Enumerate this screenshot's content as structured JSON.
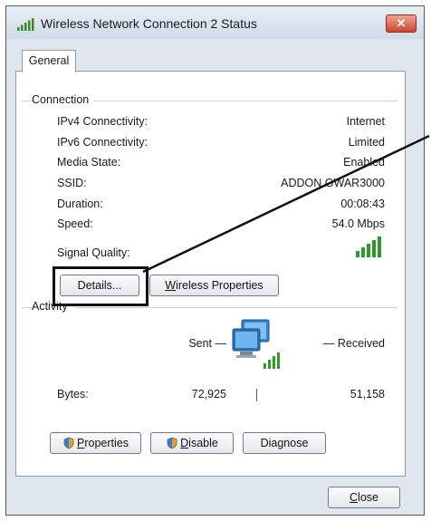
{
  "window": {
    "title": "Wireless Network Connection 2 Status",
    "close_glyph": "✕"
  },
  "tabs": [
    "General"
  ],
  "connection": {
    "section_label": "Connection",
    "rows": [
      {
        "label": "IPv4 Connectivity:",
        "value": "Internet"
      },
      {
        "label": "IPv6 Connectivity:",
        "value": "Limited"
      },
      {
        "label": "Media State:",
        "value": "Enabled"
      },
      {
        "label": "SSID:",
        "value": "ADDON GWAR3000"
      },
      {
        "label": "Duration:",
        "value": "00:08:43"
      },
      {
        "label": "Speed:",
        "value": "54.0 Mbps"
      }
    ],
    "signal_label": "Signal Quality:",
    "signal_bars": 5,
    "buttons": {
      "details": "Details...",
      "wireless_properties_prefix": "",
      "wireless_properties_mnemonic": "W",
      "wireless_properties_rest": "ireless Properties"
    }
  },
  "activity": {
    "section_label": "Activity",
    "sent_label": "Sent —",
    "received_label": "— Received",
    "bytes_label": "Bytes:",
    "bytes_sent": "72,925",
    "bytes_received": "51,158"
  },
  "bottom_buttons": {
    "properties_mnemonic": "P",
    "properties_rest": "roperties",
    "disable_mnemonic": "D",
    "disable_rest": "isable",
    "diagnose_prefix": "Dia",
    "diagnose_mnemonic": "g",
    "diagnose_rest": "nose"
  },
  "close_button": {
    "mnemonic": "C",
    "rest": "lose"
  },
  "colors": {
    "signal_green": "#2e9a2e",
    "network_blue": "#2f7fd0"
  }
}
